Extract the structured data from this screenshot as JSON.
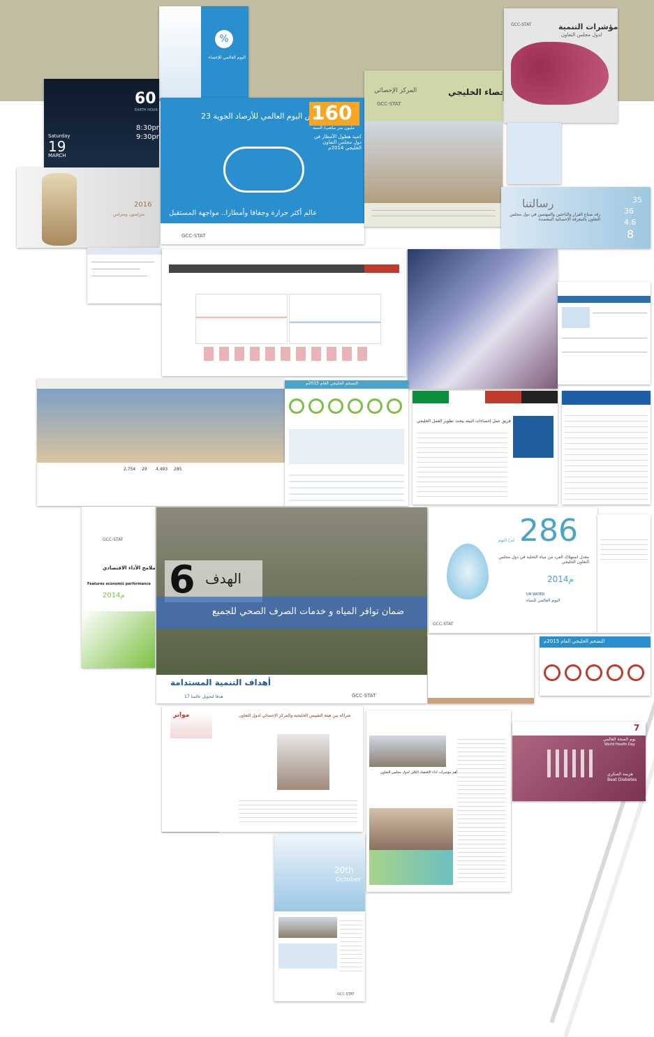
{
  "colors": {
    "band": "#c2bca1",
    "gcc_blue": "#2a8fcf",
    "sky": "#dbe9f4",
    "green": "#7ac142",
    "maroon": "#9c2d55"
  },
  "card_aqeq": {
    "percent": "%",
    "title": "اليوم العالمي للإحصاء"
  },
  "card_earth_hour": {
    "number": "60",
    "subtitle": "EARTH HOUR",
    "day": "Saturday",
    "date": "19",
    "month": "MARCH",
    "time1": "8:30pm",
    "time2": "9:30pm"
  },
  "card_met_day": {
    "heading": "23 مارس اليوم العالمي للأرصاد الجوية",
    "big_number": "160",
    "sub_number": "مليون متر مكعب/ السنة",
    "desc": "كمية هطول الأمطار في دول مجلس التعاون الخليجي 2014م",
    "tagline": "عالم أكثر حرارة وجفافا وأمطارا.. مواجهة المستقبل",
    "logo": "GCC-STAT"
  },
  "card_stat_center": {
    "title": "الإحصاء الخليجي",
    "center": "المركز الإحصائي",
    "logo": "GCC-STAT"
  },
  "card_dev_indicators": {
    "title": "مؤشرات التنمية",
    "subtitle": "لدول مجلس التعاون",
    "logo": "GCC-STAT"
  },
  "card_message": {
    "title": "رسالتنا",
    "text": "رفد صناع القرار والباحثين والمهتمين في دول مجلس التعاون بالمعرفة الإحصائية المعتمدة",
    "n1": "35",
    "n2": "4.6",
    "n3": "8",
    "n4": "36"
  },
  "card_hourglass": {
    "year": "2016",
    "text": "متزامنون ومتزامن"
  },
  "card_inflation": {
    "title": "التضخم الخليجي العام 2015م"
  },
  "card_news": {
    "title": "فريق عمل إحصاءات البيئة يبحث تطوير العمل الخليجي"
  },
  "card_twitter": {
    "followers": "2,754",
    "following": "29",
    "tweets": "4,493",
    "likes": "285"
  },
  "card_econ": {
    "title": "ملامح الأداء الاقتصادي",
    "en": "Features economic performance",
    "year": "2014م",
    "logo": "GCC-STAT"
  },
  "card_goal6": {
    "label": "الهدف",
    "number": "6",
    "caption": "ضمان توافر المياه و خدمات الصرف الصحي للجميع",
    "footer": "أهداف التنمية المستدامة",
    "footer_sub": "17 هدفا لتحويل عالمنا",
    "logo": "GCC-STAT"
  },
  "card_water": {
    "number": "286",
    "unit": "لتر/ اليوم",
    "text": "معدل استهلاك الفرد من مياه التحلية في دول مجلس التعاون الخليجي",
    "year": "2014م",
    "un": "UN WATER",
    "day": "اليوم العالمي للمياه",
    "logo": "GCC-STAT"
  },
  "card_inflation2": {
    "title": "التضخم الخليجي العام 2015م"
  },
  "card_partner": {
    "title": "شراكة بين هيئة التقييس الخليجية والمركز الإحصائي لدول التعاون",
    "ad": "مواتر"
  },
  "card_project": {
    "title": "مشروع التنبؤ بأهم مؤشرات أداء الاقتصاد الكلي لدول مجلس التعاون"
  },
  "card_diabetes": {
    "day": "7",
    "title": "يوم الصحة العالمي",
    "en_title": "World Health Day",
    "beat": "Beat Diabetes",
    "arabic": "هزيمة السكري"
  },
  "card_stats_day": {
    "number": "20th",
    "month": "October",
    "logo": "GCC-STAT"
  }
}
